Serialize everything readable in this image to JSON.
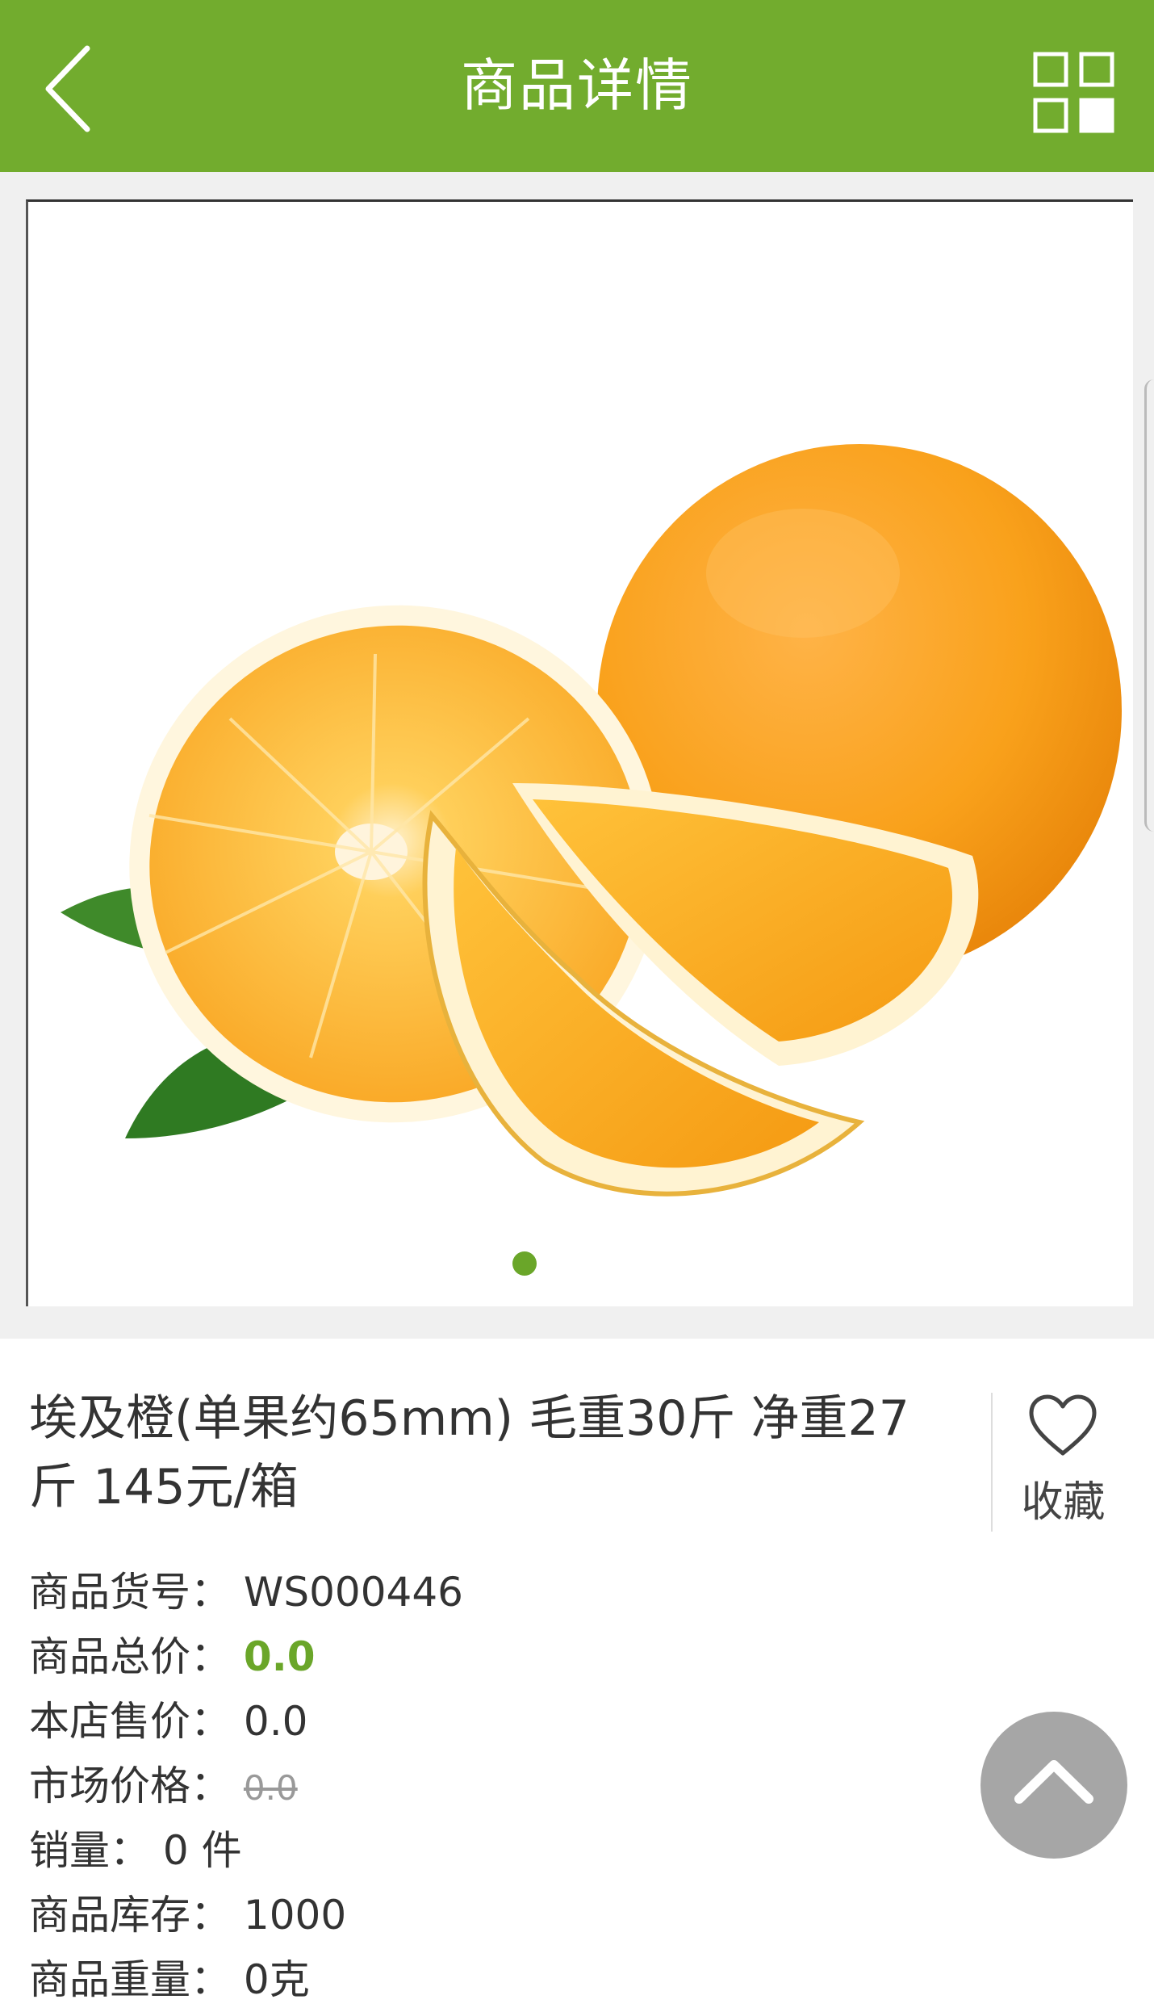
{
  "header": {
    "title": "商品详情",
    "back_icon": "chevron-left-icon",
    "menu_icon": "grid-icon",
    "background_color": "#72ac2e"
  },
  "gallery": {
    "image_description_icon": "oranges-product-image",
    "indicator_color": "#6aa629",
    "active_index": 1,
    "total": 1
  },
  "product": {
    "name": "埃及橙(单果约65mm) 毛重30斤 净重27斤 145元/箱",
    "favorite_label": "收藏",
    "favorite_icon": "heart-icon"
  },
  "specs": {
    "sku_label": "商品货号：",
    "sku_value": "WS000446",
    "total_label": "商品总价：",
    "total_value": "0.0",
    "price_label": "本店售价：",
    "price_value": "0.0",
    "market_label": "市场价格：",
    "market_value": "0.0",
    "sales_label": "销量：",
    "sales_value": "0 件",
    "stock_label": "商品库存：",
    "stock_value": "1000",
    "weight_label": "商品重量：",
    "weight_value": "0克"
  },
  "back_to_top_icon": "chevron-up-icon"
}
